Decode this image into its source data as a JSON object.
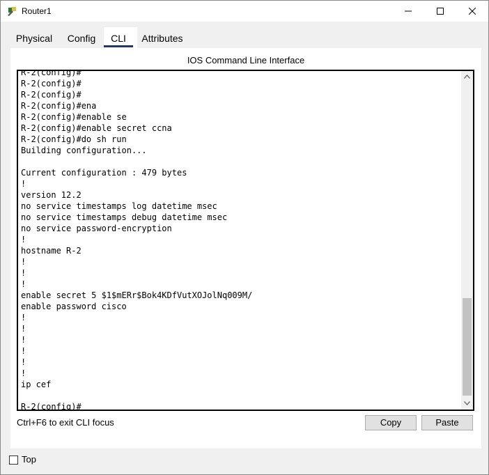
{
  "window": {
    "title": "Router1",
    "icon": "router-icon"
  },
  "tabs": [
    {
      "label": "Physical",
      "active": false
    },
    {
      "label": "Config",
      "active": false
    },
    {
      "label": "CLI",
      "active": true
    },
    {
      "label": "Attributes",
      "active": false
    }
  ],
  "cli": {
    "heading": "IOS Command Line Interface",
    "lines": [
      "R-2(config)#",
      "R-2(config)#",
      "R-2(config)#",
      "R-2(config)#ena",
      "R-2(config)#enable se",
      "R-2(config)#enable secret ccna",
      "R-2(config)#do sh run",
      "Building configuration...",
      "",
      "Current configuration : 479 bytes",
      "!",
      "version 12.2",
      "no service timestamps log datetime msec",
      "no service timestamps debug datetime msec",
      "no service password-encryption",
      "!",
      "hostname R-2",
      "!",
      "!",
      "!",
      "enable secret 5 $1$mERr$Bok4KDfVutXOJolNq009M/",
      "enable password cisco",
      "!",
      "!",
      "!",
      "!",
      "!",
      "!",
      "ip cef",
      "",
      "R-2(config)#"
    ]
  },
  "footer": {
    "hint": "Ctrl+F6 to exit CLI focus",
    "copy_label": "Copy",
    "paste_label": "Paste"
  },
  "bottom": {
    "top_label": "Top",
    "top_checked": false
  },
  "colors": {
    "tab_underline": "#1f3a5f",
    "window_bg": "#f0f0f0"
  }
}
